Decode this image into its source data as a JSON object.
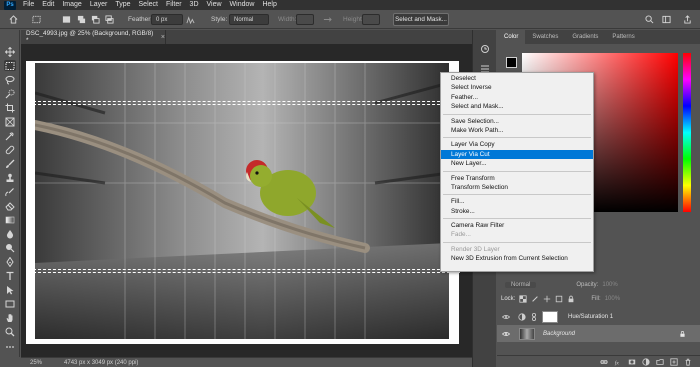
{
  "menubar": {
    "logo": "Ps",
    "items": [
      "File",
      "Edit",
      "Image",
      "Layer",
      "Type",
      "Select",
      "Filter",
      "3D",
      "View",
      "Window",
      "Help"
    ]
  },
  "options": {
    "feather_label": "Feather:",
    "feather_value": "0 px",
    "style_label": "Style:",
    "style_value": "Normal",
    "width_label": "Width:",
    "height_label": "Height:",
    "select_mask_button": "Select and Mask..."
  },
  "document": {
    "tab_title": "DSC_4993.jpg @ 25% (Background, RGB/8) *",
    "tab_close": "×"
  },
  "statusbar": {
    "zoom": "25%",
    "dimensions": "4743 px x 3049 px (240 ppi)"
  },
  "panels": {
    "tabs": [
      "Color",
      "Swatches",
      "Gradients",
      "Patterns"
    ]
  },
  "layers": {
    "mode": "Normal",
    "opacity_label": "Opacity:",
    "opacity_value": "100%",
    "lock_label": "Lock:",
    "fill_label": "Fill:",
    "fill_value": "100%",
    "items": [
      {
        "name": "Hue/Saturation 1",
        "selected": false
      },
      {
        "name": "Background",
        "selected": true
      }
    ]
  },
  "context_menu": {
    "groups": [
      [
        {
          "label": "Deselect"
        },
        {
          "label": "Select Inverse"
        },
        {
          "label": "Feather..."
        },
        {
          "label": "Select and Mask..."
        }
      ],
      [
        {
          "label": "Save Selection..."
        },
        {
          "label": "Make Work Path..."
        }
      ],
      [
        {
          "label": "Layer Via Copy"
        },
        {
          "label": "Layer Via Cut",
          "highlighted": true
        },
        {
          "label": "New Layer..."
        }
      ],
      [
        {
          "label": "Free Transform"
        },
        {
          "label": "Transform Selection"
        }
      ],
      [
        {
          "label": "Fill..."
        },
        {
          "label": "Stroke..."
        }
      ],
      [
        {
          "label": "Camera Raw Filter"
        },
        {
          "label": "Fade...",
          "disabled": true
        }
      ],
      [
        {
          "label": "Render 3D Layer",
          "disabled": true
        },
        {
          "label": "New 3D Extrusion from Current Selection"
        }
      ]
    ]
  },
  "colors": {
    "highlight": "#0078d7",
    "parrot": "#8fa72c",
    "parrot_head": "#c42a2a"
  }
}
